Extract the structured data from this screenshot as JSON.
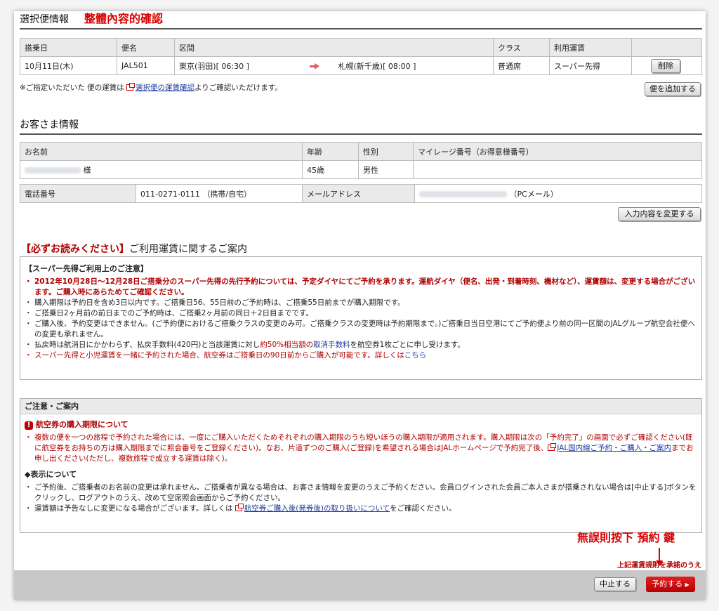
{
  "section1": {
    "title": "選択便情報",
    "annotation": "整體內容的確認"
  },
  "flight_table": {
    "headers": [
      "搭乗日",
      "便名",
      "区間",
      "",
      "クラス",
      "利用運賃",
      ""
    ],
    "row": {
      "date": "10月11日(木)",
      "flight": "JAL501",
      "from": "東京(羽田)[ 06:30 ]",
      "to": "札幌(新千歳)[ 08:00 ]",
      "class": "普通席",
      "fare": "スーパー先得",
      "delete": "削除"
    }
  },
  "fare_note": {
    "pre": "※ご指定いただいた 便の運賃は",
    "link": "選択便の運賃確認",
    "post": "よりご確認いただけます。"
  },
  "add_flight": "便を追加する",
  "section2": {
    "title": "お客さま情報"
  },
  "customer_table": {
    "headers": [
      "お名前",
      "年齢",
      "性別",
      "マイレージ番号（お得意様番号）"
    ],
    "name_suffix": "様",
    "age": "45歳",
    "gender": "男性",
    "phone_label": "電話番号",
    "phone": "011-0271-0111 （携帯/自宅）",
    "mail_label": "メールアドレス",
    "mail_suffix": "（PCメール）"
  },
  "change_input": "入力内容を変更する",
  "section3": {
    "must_read": "【必ずお読みください】",
    "title": "ご利用運賃に関するご案内"
  },
  "fare_box": {
    "heading": "【スーパー先得ご利用上のご注意】",
    "item1": "2012年10月28日～12月28日ご搭乗分のスーパー先得の先行予約については、予定ダイヤにてご予約を承ります。運航ダイヤ（便名、出発・到着時刻、機材など）、運賃額は、変更する場合がございます。ご購入時にあらためてご確認ください。",
    "item2": "購入期限は予約日を含め3日以内です。ご搭乗日56、55日前のご予約時は、ご搭乗55日前までが購入期限です。",
    "item3": "ご搭乗日2ヶ月前の前日までのご予約時は、ご搭乗2ヶ月前の同日＋2日目までです。",
    "item4": "ご購入後、予約変更はできません。(ご予約便におけるご搭乗クラスの変更のみ可。ご搭乗クラスの変更時は予約期限まで。)ご搭乗日当日空港にてご予約便より前の同一区間のJALグループ航空会社便への変更も承れません。",
    "item5_a": "払戻時は航消日にかかわらず、払戻手数料(420円)と当該運賃に対し",
    "item5_b": "約50%相当額の",
    "item5_c": "取消手数料",
    "item5_d": "を航空券1枚ごとに申し受けます。",
    "item6": "スーパー先得と小児運賃を一緒に予約された場合、航空券はご搭乗日の90日前からご購入が可能です。詳しくは",
    "item6_link": "こちら"
  },
  "notice_box": {
    "heading": "ご注意・ご案内",
    "warn_title": "航空券の購入期限について",
    "warn_text": "複数の便を一つの旅程で予約された場合には、一度にご購入いただくためそれぞれの購入期限のうち短いほうの購入期限が適用されます。購入期限は次の「予約完了」の画面で必ずご確認ください(既に航空券をお持ちの方は購入期限までに照会番号をご登録ください)。なお、片道ずつのご購入(ご登録)を希望される場合はJALホームページで予約完了後、",
    "warn_link": "JAL国内線ご予約・ご購入・ご案内",
    "warn_post": "までお申し出ください(ただし、複数旅程で成立する運賃は除く)。",
    "disp_title": "◆表示について",
    "disp1": "ご予約後、ご搭乗者のお名前の変更は承れません。ご搭乗者が異なる場合は、お客さま情報を変更のうえご予約ください。会員ログインされた会員ご本人さまが搭乗されない場合は[中止する]ボタンをクリックし、ログアウトのうえ、改めて空席照会画面からご予約ください。",
    "disp2_pre": "運賃額は予告なしに変更になる場合がございます。詳しくは",
    "disp2_link": "航空券ご購入後(発券後)の取り扱いについて",
    "disp2_post": "をご確認ください。"
  },
  "annotation2": "無誤則按下 預約 鍵",
  "agree_text": "上記運賃規則を承諾のうえ",
  "cancel": "中止する",
  "reserve": "予約する"
}
